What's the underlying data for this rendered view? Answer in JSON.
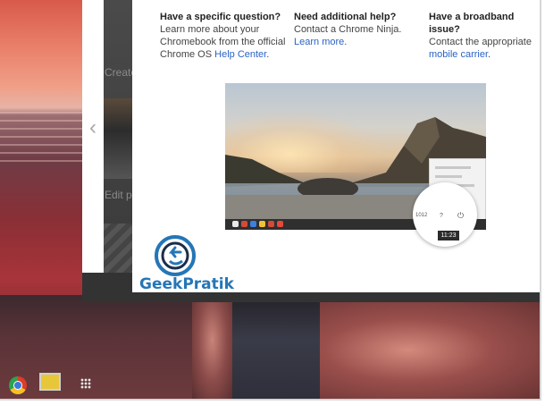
{
  "help": {
    "col1": {
      "heading": "Have a specific question?",
      "text_before": "Learn more about your Chromebook from the official Chrome OS",
      "link": "Help Center",
      "text_after": "."
    },
    "col2": {
      "heading": "Need additional help?",
      "text_before": "Contact a Chrome Ninja.",
      "link": "Learn more",
      "text_after": "."
    },
    "col3": {
      "heading": "Have a broadband issue?",
      "text_before": "Contact the appropriate",
      "link": "mobile carrier",
      "text_after": "."
    }
  },
  "background_window": {
    "label_create": "Create",
    "label_edit": "Edit p"
  },
  "magnifier": {
    "left_value": "1012",
    "help_glyph": "?",
    "power_glyph": "⏻",
    "time": "11:23"
  },
  "watermark": {
    "brand": "GeekPratik"
  },
  "nav": {
    "back_glyph": "‹"
  },
  "colors": {
    "link": "#2a63c4",
    "brand": "#2576b6"
  },
  "icons": {
    "back": "chevron-left-icon",
    "browser": "chrome-icon",
    "files": "files-icon",
    "apps": "app-launcher-icon"
  }
}
